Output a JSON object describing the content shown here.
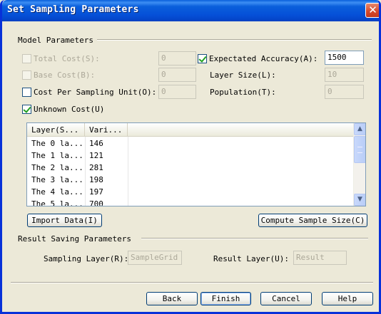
{
  "window": {
    "title": "Set Sampling Parameters",
    "close_symbol": "✕"
  },
  "model": {
    "section_label": "Model Parameters",
    "total_cost": {
      "label": "Total Cost(S):",
      "value": "0",
      "checked": false,
      "enabled": false
    },
    "base_cost": {
      "label": "Base Cost(B):",
      "value": "0",
      "checked": false,
      "enabled": false
    },
    "cost_per_unit": {
      "label": "Cost Per Sampling Unit(O):",
      "value": "0",
      "checked": false,
      "enabled": true
    },
    "unknown_cost": {
      "label": "Unknown Cost(U)",
      "checked": true
    },
    "expected_accuracy": {
      "label": "Expectated Accuracy(A):",
      "value": "1500",
      "checked": true
    },
    "layer_size": {
      "label": "Layer Size(L):",
      "value": "10"
    },
    "population": {
      "label": "Population(T):",
      "value": "0"
    }
  },
  "table": {
    "columns": [
      "Layer(S...",
      "Vari..."
    ],
    "rows": [
      [
        "The 0 la...",
        "146"
      ],
      [
        "The 1 la...",
        "121"
      ],
      [
        "The 2 la...",
        "281"
      ],
      [
        "The 3 la...",
        "198"
      ],
      [
        "The 4 la...",
        "197"
      ],
      [
        "The 5 la...",
        "700"
      ]
    ]
  },
  "buttons": {
    "import": "Import Data(I)",
    "compute": "Compute Sample Size(C)",
    "back": "Back",
    "finish": "Finish",
    "cancel": "Cancel",
    "help": "Help"
  },
  "result": {
    "section_label": "Result Saving Parameters",
    "sampling_layer": {
      "label": "Sampling Layer(R):",
      "value": "SampleGrid"
    },
    "result_layer": {
      "label": "Result Layer(U):",
      "value": "Result"
    }
  },
  "icons": {
    "scroll_up": "▲",
    "scroll_down": "▼"
  }
}
